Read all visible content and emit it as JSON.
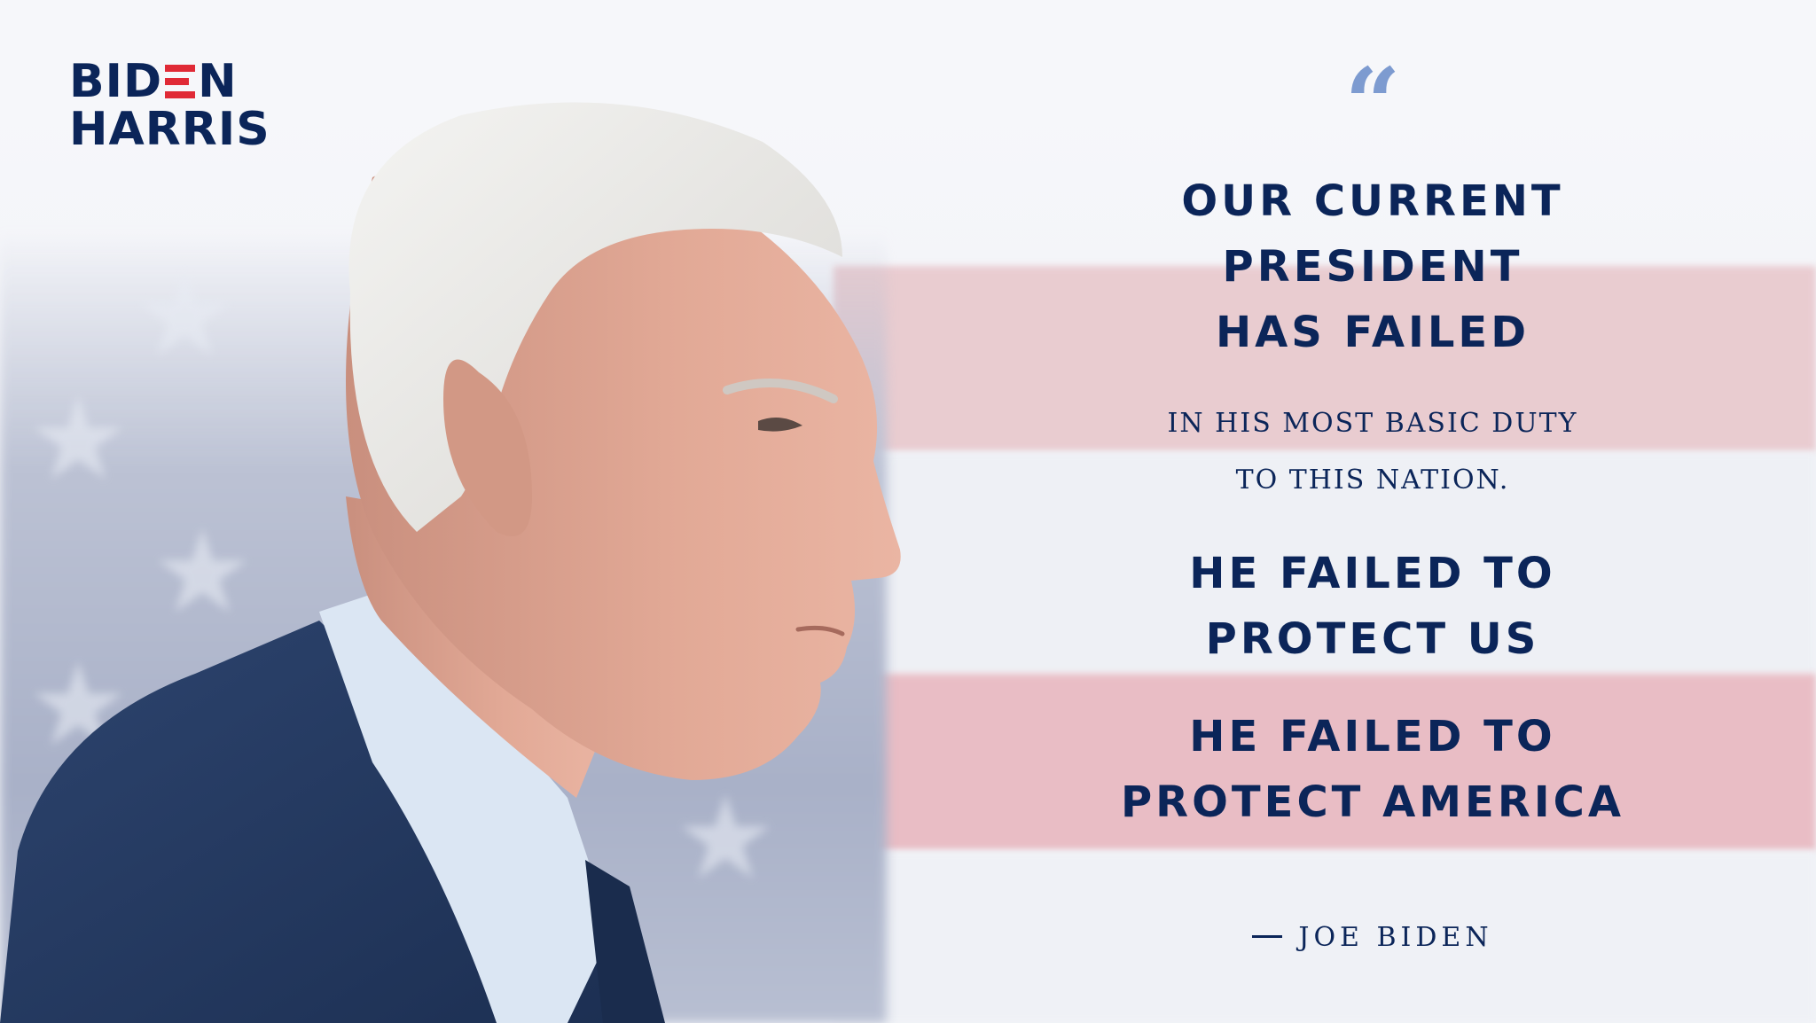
{
  "logo": {
    "line1_left": "BID",
    "line1_right": "N",
    "line2": "HARRIS",
    "brand_navy": "#0b2559",
    "brand_red": "#e02a36"
  },
  "quote": {
    "mark": "“",
    "headline_1": [
      "OUR CURRENT",
      "PRESIDENT",
      "HAS FAILED"
    ],
    "subline": [
      "IN HIS MOST BASIC DUTY",
      "TO THIS NATION."
    ],
    "headline_2": [
      "HE FAILED TO",
      "PROTECT US"
    ],
    "headline_3": [
      "HE FAILED TO",
      "PROTECT AMERICA"
    ],
    "attribution": "JOE BIDEN",
    "mark_color": "#7d9bd0"
  },
  "background": {
    "description_icon": "american-flag-blurred"
  }
}
